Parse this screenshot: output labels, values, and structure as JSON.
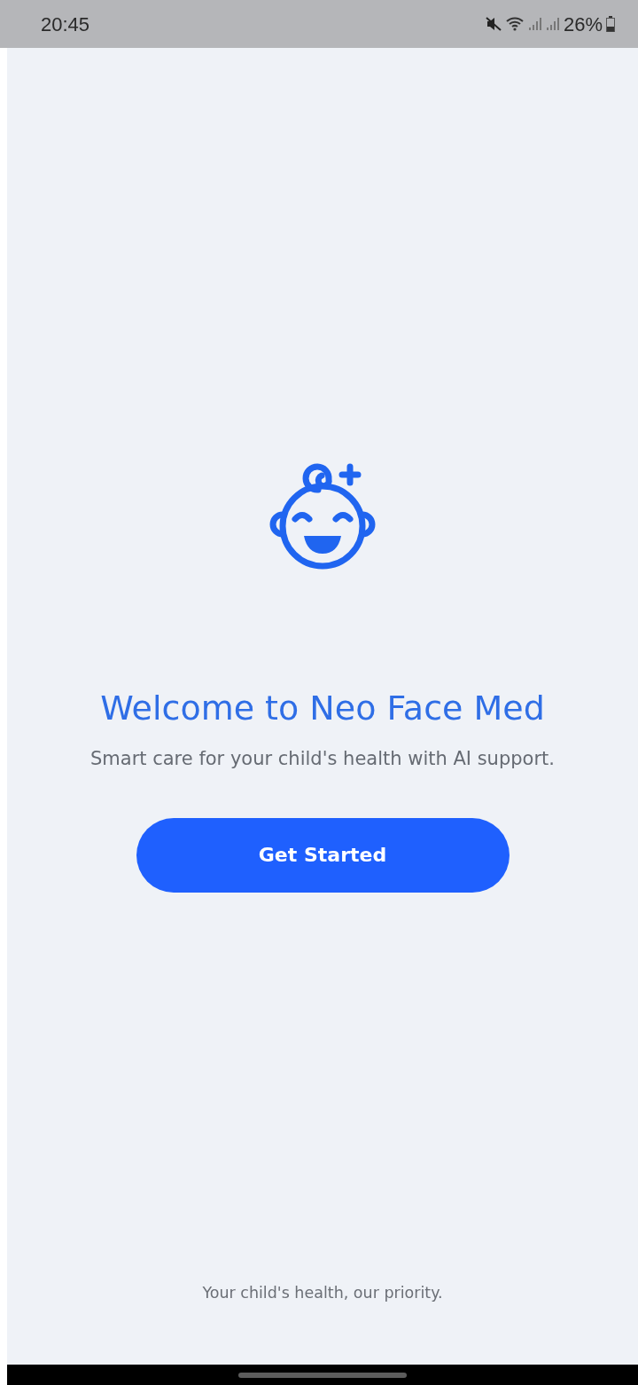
{
  "status_bar": {
    "time": "20:45",
    "battery": "26%"
  },
  "title": "Welcome to Neo Face Med",
  "subtitle": "Smart care for your child's health with AI support.",
  "button": "Get Started",
  "footer": "Your child's health, our priority."
}
